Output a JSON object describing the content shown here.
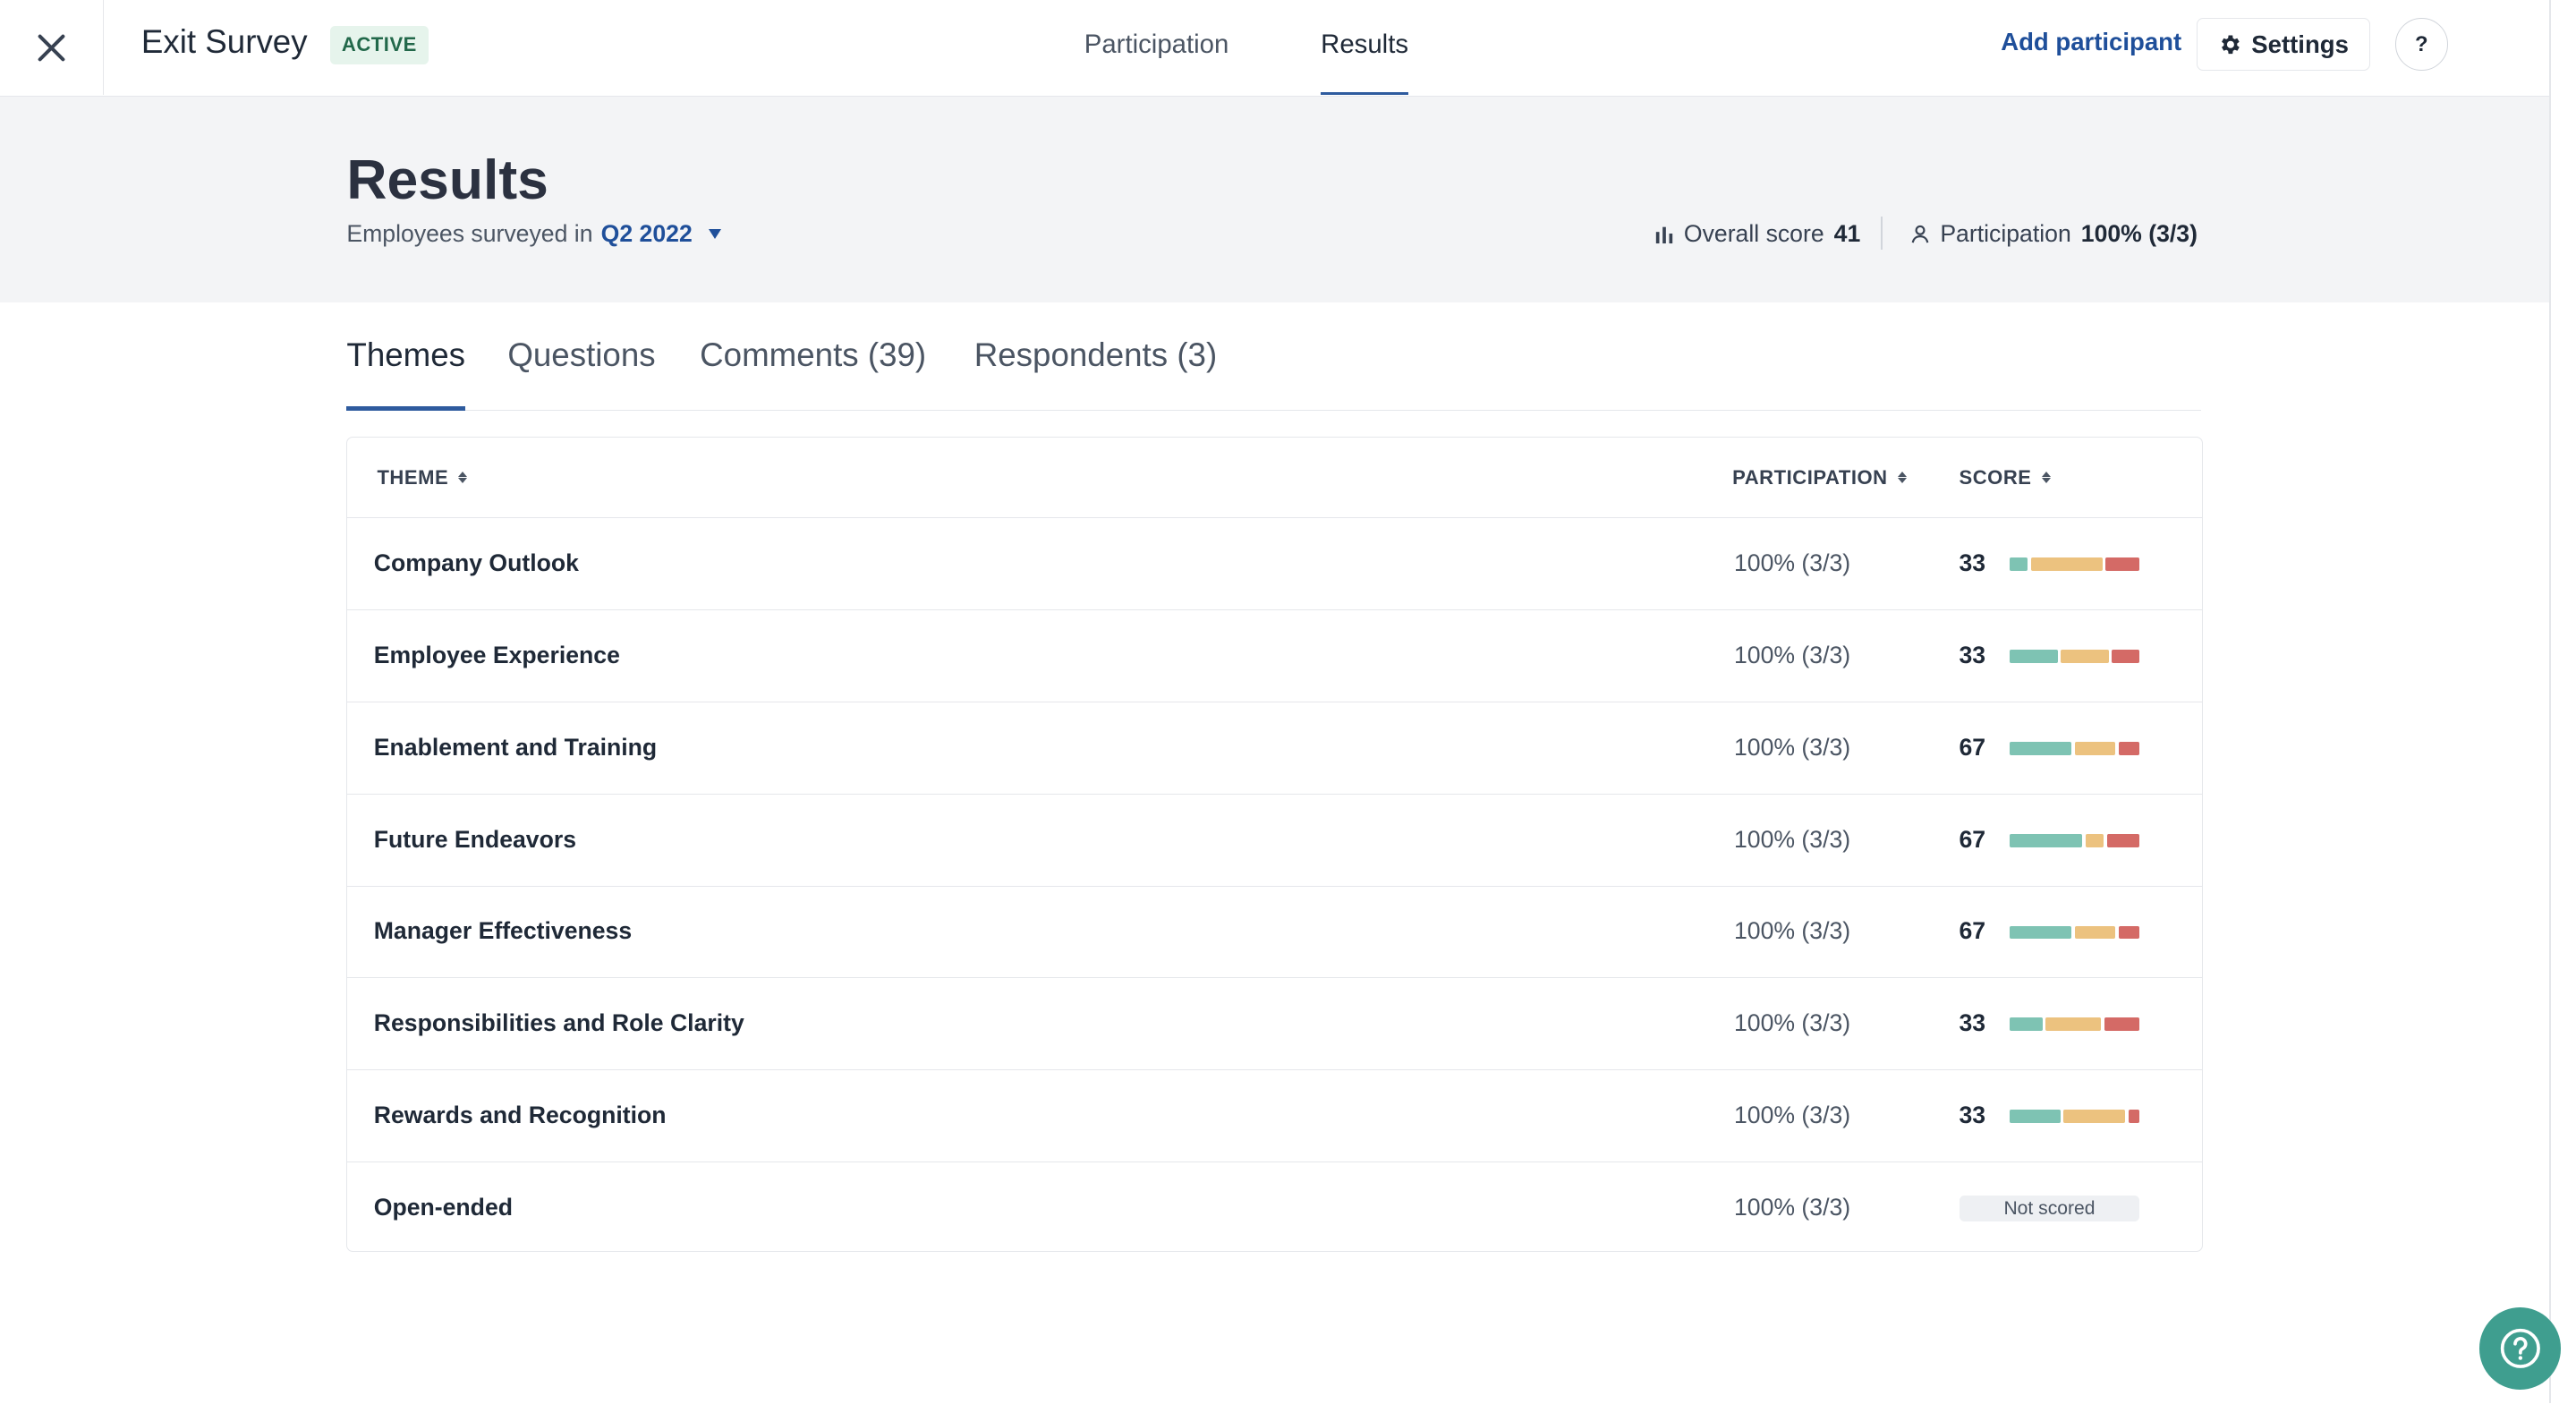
{
  "header": {
    "survey_title": "Exit Survey",
    "status": "ACTIVE",
    "nav_tabs": [
      {
        "label": "Participation",
        "active": false
      },
      {
        "label": "Results",
        "active": true
      }
    ],
    "add_participant": "Add participant",
    "settings": "Settings",
    "help": "?"
  },
  "summary": {
    "title": "Results",
    "subtitle_prefix": "Employees surveyed in",
    "period": "Q2 2022",
    "overall_score_label": "Overall score",
    "overall_score_value": "41",
    "participation_label": "Participation",
    "participation_value": "100% (3/3)"
  },
  "content_tabs": [
    {
      "label": "Themes",
      "active": true
    },
    {
      "label": "Questions",
      "active": false
    },
    {
      "label": "Comments (39)",
      "active": false
    },
    {
      "label": "Respondents (3)",
      "active": false
    }
  ],
  "table": {
    "columns": [
      "THEME",
      "PARTICIPATION",
      "SCORE"
    ],
    "rows": [
      {
        "theme": "Company Outlook",
        "participation": "100% (3/3)",
        "score": "33",
        "distribution": [
          0.14,
          0.58,
          0.28
        ]
      },
      {
        "theme": "Employee Experience",
        "participation": "100% (3/3)",
        "score": "33",
        "distribution": [
          0.39,
          0.39,
          0.22
        ]
      },
      {
        "theme": "Enablement and Training",
        "participation": "100% (3/3)",
        "score": "67",
        "distribution": [
          0.5,
          0.33,
          0.17
        ]
      },
      {
        "theme": "Future Endeavors",
        "participation": "100% (3/3)",
        "score": "67",
        "distribution": [
          0.58,
          0.15,
          0.27
        ]
      },
      {
        "theme": "Manager Effectiveness",
        "participation": "100% (3/3)",
        "score": "67",
        "distribution": [
          0.5,
          0.33,
          0.17
        ]
      },
      {
        "theme": "Responsibilities and Role Clarity",
        "participation": "100% (3/3)",
        "score": "33",
        "distribution": [
          0.26,
          0.45,
          0.29
        ]
      },
      {
        "theme": "Rewards and Recognition",
        "participation": "100% (3/3)",
        "score": "33",
        "distribution": [
          0.41,
          0.5,
          0.09
        ]
      },
      {
        "theme": "Open-ended",
        "participation": "100% (3/3)",
        "score": null,
        "not_scored": "Not scored"
      }
    ]
  },
  "colors": {
    "accent": "#2e5b9e",
    "favorable": "#7ec3b3",
    "neutral": "#ecc27f",
    "unfavorable": "#d46a66",
    "help_fab": "#3f9e8f"
  }
}
